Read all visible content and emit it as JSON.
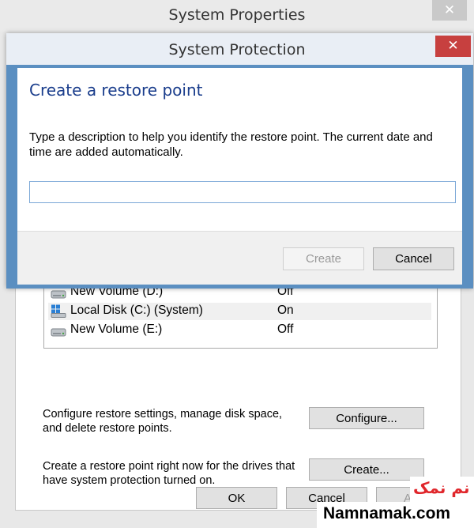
{
  "system_properties": {
    "title": "System Properties",
    "close_glyph": "✕",
    "drives": [
      {
        "name": "New Volume (D:)",
        "status": "Off",
        "icon": "drive-icon"
      },
      {
        "name": "Local Disk (C:) (System)",
        "status": "On",
        "icon": "system-drive-icon"
      },
      {
        "name": "New Volume (E:)",
        "status": "Off",
        "icon": "drive-icon"
      }
    ],
    "configure_text_1": "Configure restore settings, manage disk space,",
    "configure_text_2": "and delete restore points.",
    "configure_button": "Configure...",
    "create_text_1": "Create a restore point right now for the drives that",
    "create_text_2": "have system protection turned on.",
    "create_button": "Create...",
    "ok_button": "OK",
    "cancel_button": "Cancel",
    "apply_button_partial": "A"
  },
  "system_protection": {
    "title": "System Protection",
    "close_glyph": "✕",
    "heading": "Create a restore point",
    "instruction_1": "Type a description to help you identify the restore point. The current date and",
    "instruction_2": "time are added automatically.",
    "description_value": "",
    "create_button": "Create",
    "cancel_button": "Cancel"
  },
  "watermark": {
    "persian": "نم نمک",
    "domain": "Namnamak.com"
  },
  "colors": {
    "dialog_border": "#5b8fc1",
    "heading": "#1a3d8c",
    "close_active": "#c7403f"
  }
}
